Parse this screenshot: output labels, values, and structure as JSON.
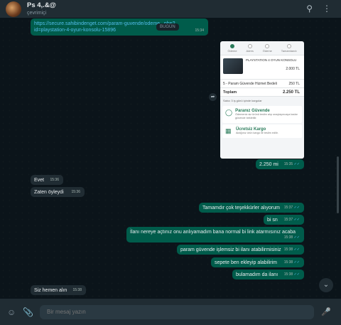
{
  "header": {
    "name": "Ps 4,.&@",
    "status": "çevrimiçi"
  },
  "date_pill": "BUGÜN",
  "link_message": {
    "text": "https://secure.sahibindenget.com/param-guvende/odeme...php?id=playstation-4-oyun-konsolu-15896",
    "time": "15:34"
  },
  "card": {
    "steps": [
      "Ödeme",
      "Adres",
      "Ödeme",
      "Tamamlandı"
    ],
    "product": "PLAYSTATION 4 OYUN KONSOLU",
    "product_price": "2.000 TL",
    "fee_label": "5 - Param Güvende Hizmet Bedeli",
    "fee_value": "250 TL",
    "total_label": "Toplam",
    "total_value": "2.250 TL",
    "note": "Satıcı 3 iş günü içinde kargolar",
    "feature1_title": "Paranız Güvende",
    "feature1_desc": "Ödemeniz siz ürünü teslim alıp onaylayıncaya kadar güvende bekletilir.",
    "feature2_title": "Ücretsiz Kargo",
    "feature2_desc": "Aldığınız ürün kargo ile teslim edilir."
  },
  "messages": [
    {
      "dir": "out",
      "text": "2.250 mi",
      "time": "15:35"
    },
    {
      "dir": "in",
      "text": "Evet",
      "time": "15:36"
    },
    {
      "dir": "in",
      "text": "Zaten öyleydi",
      "time": "15:36"
    },
    {
      "dir": "out",
      "text": "Tamamdır çok teşekkürler alıyorum",
      "time": "15:37"
    },
    {
      "dir": "out",
      "text": "bi sn",
      "time": "15:37"
    },
    {
      "dir": "out",
      "text": "İlanı nereye açtınız onu anlıyamadım bana normal bi link atarmısınız acaba",
      "time": "15:38"
    },
    {
      "dir": "out",
      "text": "param güvende işlemsiz bi ilanı atabilirmisiniz",
      "time": "15:38"
    },
    {
      "dir": "out",
      "text": "sepete ben ekleyip alabilirim",
      "time": "15:38"
    },
    {
      "dir": "out",
      "text": "bulamadım da ilanı",
      "time": "15:38"
    },
    {
      "dir": "in",
      "text": "Siz hemen alın",
      "time": "15:38"
    }
  ],
  "footer": {
    "placeholder": "Bir mesaj yazın"
  },
  "icons": {
    "search": "search-icon",
    "menu": "menu-icon",
    "emoji": "emoji-icon",
    "attach": "attach-icon",
    "mic": "mic-icon",
    "scroll_down": "chevron-down-icon"
  },
  "colors": {
    "outgoing_bubble": "#005c4b",
    "incoming_bubble": "#202c33",
    "read_tick": "#53bdeb",
    "background": "#0b141a"
  }
}
